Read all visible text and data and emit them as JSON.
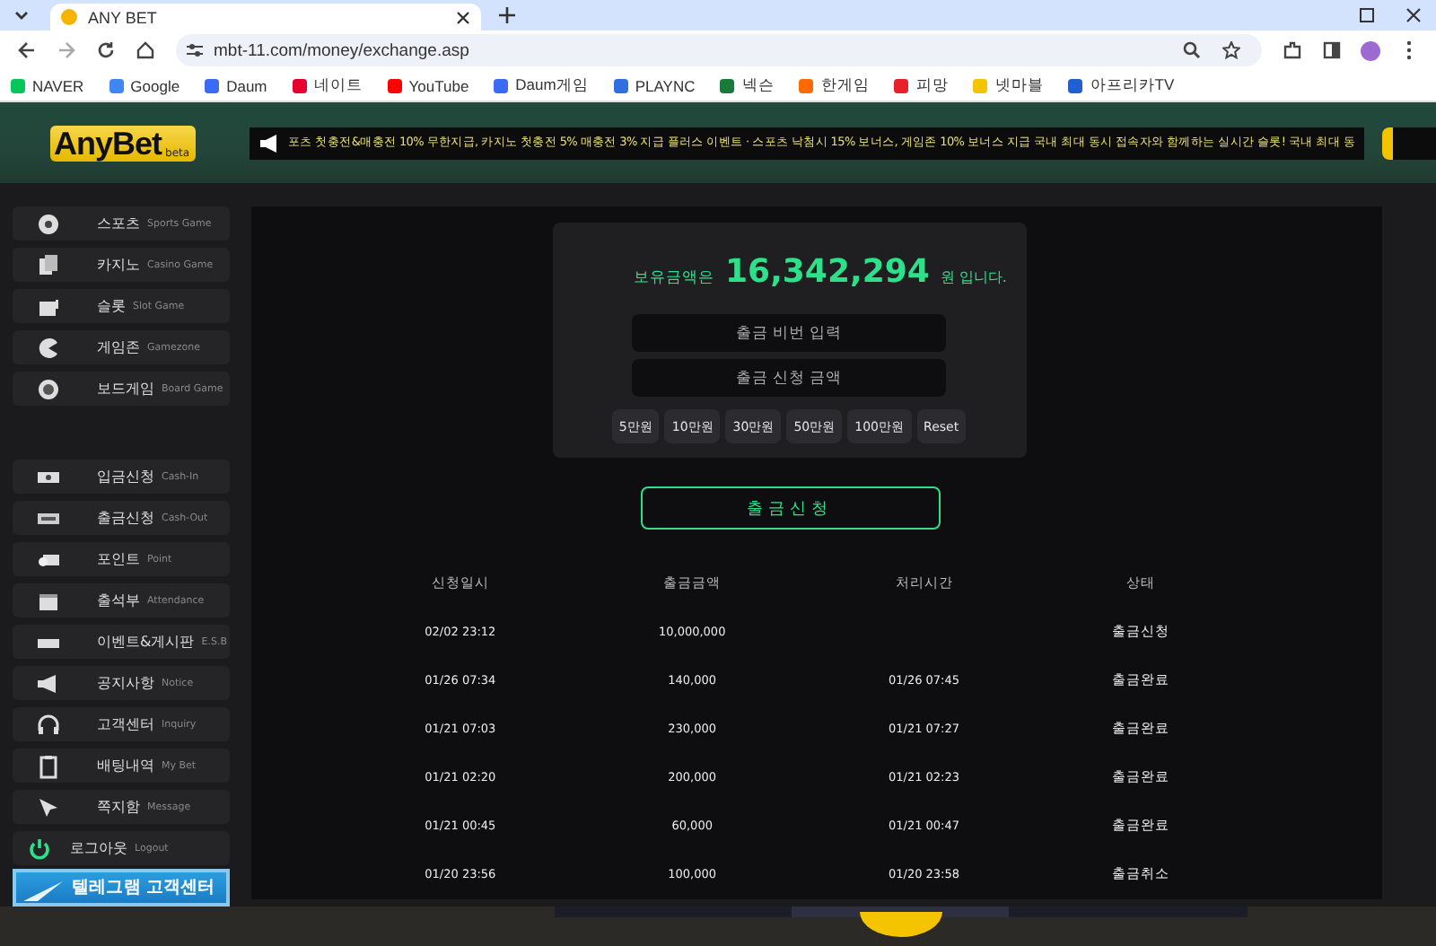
{
  "browser": {
    "tab_title": "ANY BET",
    "url": "mbt-11.com/money/exchange.asp",
    "bookmarks": [
      "NAVER",
      "Google",
      "Daum",
      "네이트",
      "YouTube",
      "Daum게임",
      "PLAYNC",
      "넥슨",
      "한게임",
      "피망",
      "넷마블",
      "아프리카TV"
    ]
  },
  "header": {
    "logo": "AnyBet",
    "logo_sub": "beta",
    "ticker": "포츠 첫충전&매충전 10% 무한지급, 카지노 첫충전 5% 매충전 3% 지급 플러스 이벤트 · 스포츠 낙첨시 15% 보너스, 게임존 10% 보너스 지급 국내 최대 동시 접속자와 함께하는 실시간 슬롯! 국내 최대 동"
  },
  "sidebar": {
    "games": [
      {
        "label": "스포츠",
        "sub": "Sports Game"
      },
      {
        "label": "카지노",
        "sub": "Casino Game"
      },
      {
        "label": "슬롯",
        "sub": "Slot Game"
      },
      {
        "label": "게임존",
        "sub": "Gamezone"
      },
      {
        "label": "보드게임",
        "sub": "Board Game"
      }
    ],
    "menu": [
      {
        "label": "입금신청",
        "sub": "Cash-In"
      },
      {
        "label": "출금신청",
        "sub": "Cash-Out"
      },
      {
        "label": "포인트",
        "sub": "Point"
      },
      {
        "label": "출석부",
        "sub": "Attendance"
      },
      {
        "label": "이벤트&게시판",
        "sub": "E.S.B"
      },
      {
        "label": "공지사항",
        "sub": "Notice"
      },
      {
        "label": "고객센터",
        "sub": "Inquiry"
      },
      {
        "label": "배팅내역",
        "sub": "My Bet"
      },
      {
        "label": "쪽지함",
        "sub": "Message"
      }
    ],
    "logout": {
      "label": "로그아웃",
      "sub": "Logout"
    },
    "banner": "텔레그램 고객센터"
  },
  "balance": {
    "prefix": "보유금액은",
    "amount": "16,342,294",
    "suffix": "원 입니다."
  },
  "form": {
    "password": {
      "placeholder": "출금 비번 입력"
    },
    "amount": {
      "placeholder": "출금 신청 금액"
    },
    "quick_amounts": [
      "5만원",
      "10만원",
      "30만원",
      "50만원",
      "100만원",
      "Reset"
    ],
    "submit": "출금신청"
  },
  "history": {
    "columns": [
      "신청일시",
      "출금금액",
      "처리시간",
      "상태"
    ],
    "rows": [
      [
        "02/02 23:12",
        "10,000,000",
        "",
        "출금신청"
      ],
      [
        "01/26 07:34",
        "140,000",
        "01/26 07:45",
        "출금완료"
      ],
      [
        "01/21 07:03",
        "230,000",
        "01/21 07:27",
        "출금완료"
      ],
      [
        "01/21 02:20",
        "200,000",
        "01/21 02:23",
        "출금완료"
      ],
      [
        "01/21 00:45",
        "60,000",
        "01/21 00:47",
        "출금완료"
      ],
      [
        "01/20 23:56",
        "100,000",
        "01/20 23:58",
        "출금취소"
      ]
    ]
  }
}
